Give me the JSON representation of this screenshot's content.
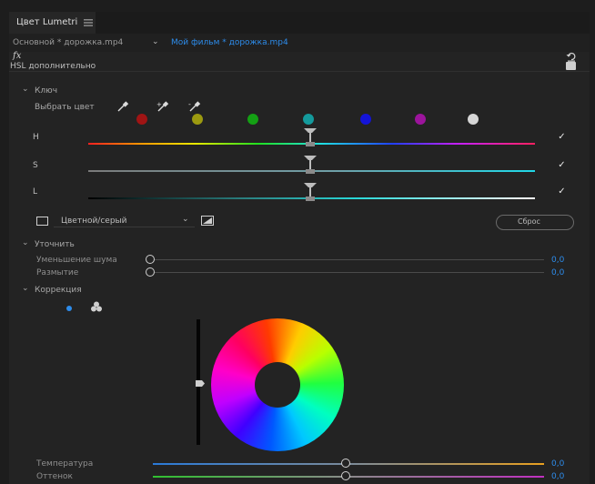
{
  "panel": {
    "title": "Цвет Lumetri",
    "menu_icon": "hamburger-icon"
  },
  "tabs": {
    "source": "Основной * дорожка.mp4",
    "sequence": "Мой фильм * дорожка.mp4"
  },
  "effect": {
    "fx_label": "fx",
    "section": "HSL дополнительно",
    "reset_icon": "reset-icon",
    "enabled_icon": "checkbox-icon"
  },
  "key": {
    "section": "Ключ",
    "select_color_label": "Выбрать цвет",
    "eyedroppers": [
      "eyedropper-icon",
      "eyedropper-add-icon",
      "eyedropper-remove-icon"
    ],
    "swatches": [
      "#a01414",
      "#9c9a10",
      "#14a014",
      "#149a9c",
      "#1414d8",
      "#9c149c",
      "#d6d6d6"
    ],
    "sliders": [
      {
        "label": "H",
        "checked": true
      },
      {
        "label": "S",
        "checked": true
      },
      {
        "label": "L",
        "checked": true
      }
    ],
    "display_mode": "Цветной/серый",
    "reset_label": "Сброс"
  },
  "refine": {
    "section": "Уточнить",
    "rows": [
      {
        "label": "Уменьшение шума",
        "value": "0,0",
        "fraction": 0.0
      },
      {
        "label": "Размытие",
        "value": "0,0",
        "fraction": 0.0
      }
    ]
  },
  "correction": {
    "section": "Коррекция",
    "rows": [
      {
        "label": "Температура",
        "value": "0,0",
        "fraction": 0.5
      },
      {
        "label": "Оттенок",
        "value": "0,0",
        "fraction": 0.5
      }
    ]
  }
}
